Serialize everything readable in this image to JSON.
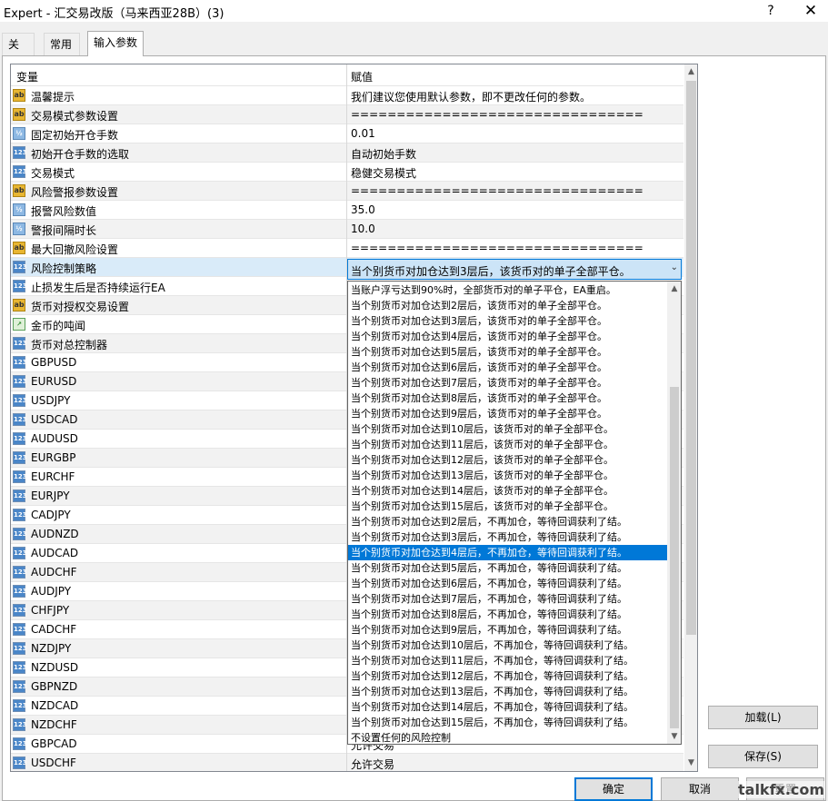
{
  "window": {
    "title": "Expert - 汇交易改版（马来西亚28B）(3)",
    "help_label": "?",
    "close_label": "✕"
  },
  "tabs": [
    {
      "label": "关于"
    },
    {
      "label": "常用"
    },
    {
      "label": "输入参数",
      "active": true
    }
  ],
  "grid": {
    "col_variable": "变量",
    "col_value": "赋值",
    "rows": [
      {
        "icon": "ab",
        "name": "温馨提示",
        "value": "我们建议您使用默认参数，即不更改任何的参数。"
      },
      {
        "icon": "ab",
        "name": "交易模式参数设置",
        "value": "================================"
      },
      {
        "icon": "half",
        "name": "固定初始开仓手数",
        "value": "0.01"
      },
      {
        "icon": "123",
        "name": "初始开仓手数的选取",
        "value": "自动初始手数"
      },
      {
        "icon": "123",
        "name": "交易模式",
        "value": "稳健交易模式"
      },
      {
        "icon": "ab",
        "name": "风险警报参数设置",
        "value": "================================"
      },
      {
        "icon": "half",
        "name": "报警风险数值",
        "value": "35.0"
      },
      {
        "icon": "half",
        "name": "警报间隔时长",
        "value": "10.0"
      },
      {
        "icon": "ab",
        "name": "最大回撤风险设置",
        "value": "================================"
      },
      {
        "icon": "123",
        "name": "风险控制策略",
        "value": ""
      },
      {
        "icon": "123",
        "name": "止损发生后是否持续运行EA",
        "value": ""
      },
      {
        "icon": "ab",
        "name": "货币对授权交易设置",
        "value": ""
      },
      {
        "icon": "chart",
        "name": "金币的吨闻",
        "value": ""
      },
      {
        "icon": "123",
        "name": "货币对总控制器",
        "value": ""
      },
      {
        "icon": "123",
        "name": "GBPUSD",
        "value": ""
      },
      {
        "icon": "123",
        "name": "EURUSD",
        "value": ""
      },
      {
        "icon": "123",
        "name": "USDJPY",
        "value": ""
      },
      {
        "icon": "123",
        "name": "USDCAD",
        "value": ""
      },
      {
        "icon": "123",
        "name": "AUDUSD",
        "value": ""
      },
      {
        "icon": "123",
        "name": "EURGBP",
        "value": ""
      },
      {
        "icon": "123",
        "name": "EURCHF",
        "value": ""
      },
      {
        "icon": "123",
        "name": "EURJPY",
        "value": ""
      },
      {
        "icon": "123",
        "name": "CADJPY",
        "value": ""
      },
      {
        "icon": "123",
        "name": "AUDNZD",
        "value": ""
      },
      {
        "icon": "123",
        "name": "AUDCAD",
        "value": ""
      },
      {
        "icon": "123",
        "name": "AUDCHF",
        "value": ""
      },
      {
        "icon": "123",
        "name": "AUDJPY",
        "value": ""
      },
      {
        "icon": "123",
        "name": "CHFJPY",
        "value": ""
      },
      {
        "icon": "123",
        "name": "CADCHF",
        "value": ""
      },
      {
        "icon": "123",
        "name": "NZDJPY",
        "value": ""
      },
      {
        "icon": "123",
        "name": "NZDUSD",
        "value": ""
      },
      {
        "icon": "123",
        "name": "GBPNZD",
        "value": ""
      },
      {
        "icon": "123",
        "name": "NZDCAD",
        "value": ""
      },
      {
        "icon": "123",
        "name": "NZDCHF",
        "value": ""
      },
      {
        "icon": "123",
        "name": "GBPCAD",
        "value": "允许交易"
      },
      {
        "icon": "123",
        "name": "USDCHF",
        "value": "允许交易"
      }
    ]
  },
  "combo": {
    "value": "当个别货币对加仓达到3层后，该货币对的单子全部平仓。",
    "arrow": "⌄"
  },
  "dropdown": {
    "highlighted_index": 17,
    "options": [
      "当账户浮亏达到90%时，全部货币对的单子平仓，EA重启。",
      "当个别货币对加仓达到2层后，该货币对的单子全部平仓。",
      "当个别货币对加仓达到3层后，该货币对的单子全部平仓。",
      "当个别货币对加仓达到4层后，该货币对的单子全部平仓。",
      "当个别货币对加仓达到5层后，该货币对的单子全部平仓。",
      "当个别货币对加仓达到6层后，该货币对的单子全部平仓。",
      "当个别货币对加仓达到7层后，该货币对的单子全部平仓。",
      "当个别货币对加仓达到8层后，该货币对的单子全部平仓。",
      "当个别货币对加仓达到9层后，该货币对的单子全部平仓。",
      "当个别货币对加仓达到10层后，该货币对的单子全部平仓。",
      "当个别货币对加仓达到11层后，该货币对的单子全部平仓。",
      "当个别货币对加仓达到12层后，该货币对的单子全部平仓。",
      "当个别货币对加仓达到13层后，该货币对的单子全部平仓。",
      "当个别货币对加仓达到14层后，该货币对的单子全部平仓。",
      "当个别货币对加仓达到15层后，该货币对的单子全部平仓。",
      "当个别货币对加仓达到2层后，不再加仓，等待回调获利了结。",
      "当个别货币对加仓达到3层后，不再加仓，等待回调获利了结。",
      "当个别货币对加仓达到4层后，不再加仓，等待回调获利了结。",
      "当个别货币对加仓达到5层后，不再加仓，等待回调获利了结。",
      "当个别货币对加仓达到6层后，不再加仓，等待回调获利了结。",
      "当个别货币对加仓达到7层后，不再加仓，等待回调获利了结。",
      "当个别货币对加仓达到8层后，不再加仓，等待回调获利了结。",
      "当个别货币对加仓达到9层后，不再加仓，等待回调获利了结。",
      "当个别货币对加仓达到10层后，不再加仓，等待回调获利了结。",
      "当个别货币对加仓达到11层后，不再加仓，等待回调获利了结。",
      "当个别货币对加仓达到12层后，不再加仓，等待回调获利了结。",
      "当个别货币对加仓达到13层后，不再加仓，等待回调获利了结。",
      "当个别货币对加仓达到14层后，不再加仓，等待回调获利了结。",
      "当个别货币对加仓达到15层后，不再加仓，等待回调获利了结。",
      "不设置任何的风险控制"
    ]
  },
  "buttons": {
    "load": "加载(L)",
    "save": "保存(S)",
    "ok": "确定",
    "cancel": "取消",
    "reset": "重置"
  },
  "watermark": "talkfx.com",
  "icons": {
    "ab": "ab",
    "123": "123",
    "half": "½",
    "chart": "↗"
  }
}
